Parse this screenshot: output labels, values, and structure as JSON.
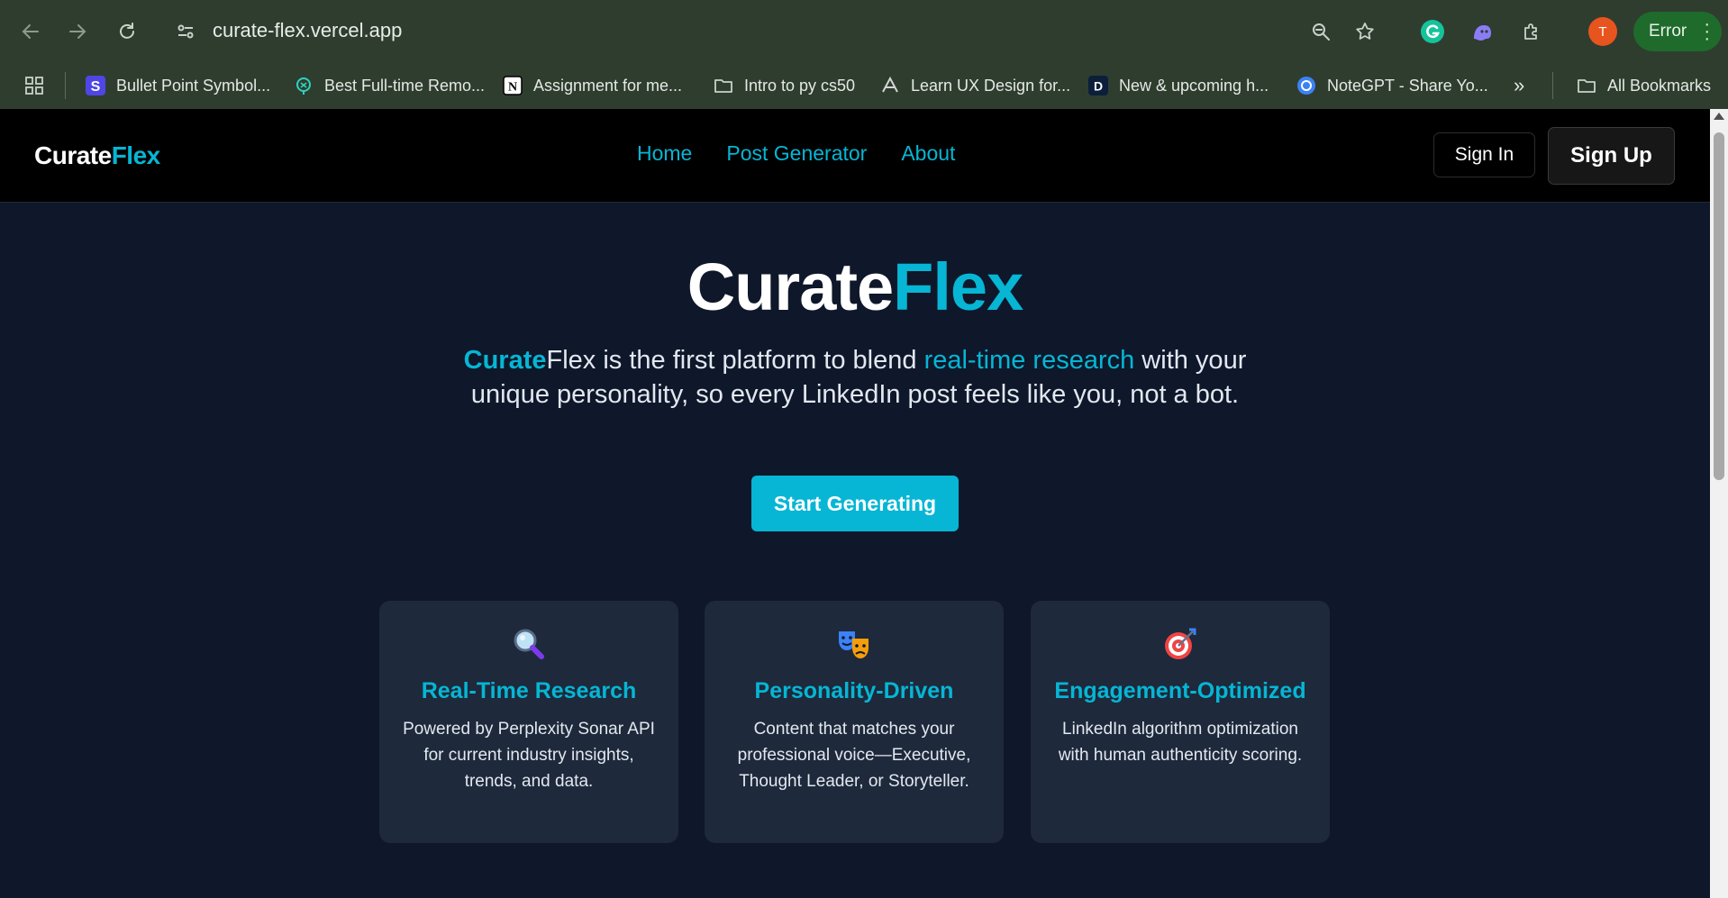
{
  "browser": {
    "url": "curate-flex.vercel.app",
    "profile_initial": "T",
    "error_label": "Error",
    "bookmarks": [
      {
        "label": "Bullet Point Symbol...",
        "icon": "s-logo-icon"
      },
      {
        "label": "Best Full-time Remo...",
        "icon": "location-pin-icon"
      },
      {
        "label": "Assignment for me...",
        "icon": "notion-icon"
      },
      {
        "label": "Intro to py cs50",
        "icon": "folder-icon"
      },
      {
        "label": "Learn UX Design for...",
        "icon": "site-icon"
      },
      {
        "label": "New & upcoming h...",
        "icon": "d-logo-icon"
      },
      {
        "label": "NoteGPT - Share Yo...",
        "icon": "swirl-icon"
      }
    ],
    "more_label": "»",
    "all_bookmarks_label": "All Bookmarks"
  },
  "nav": {
    "logo_part1": "Curate",
    "logo_part2": "Flex",
    "links": [
      "Home",
      "Post Generator",
      "About"
    ],
    "sign_in": "Sign In",
    "sign_up": "Sign Up"
  },
  "hero": {
    "title_part1": "Curate",
    "title_part2": "Flex",
    "sub_brand1": "Curate",
    "sub_brand2": "Flex",
    "sub_text1": " is the first platform to blend ",
    "sub_highlight": "real-time research",
    "sub_text2": " with your unique personality, so every LinkedIn post feels like you, not a bot.",
    "cta": "Start Generating"
  },
  "features": [
    {
      "title": "Real-Time Research",
      "description": "Powered by Perplexity Sonar API for current industry insights, trends, and data.",
      "icon": "magnifier-icon"
    },
    {
      "title": "Personality-Driven",
      "description": "Content that matches your professional voice—Executive, Thought Leader, or Storyteller.",
      "icon": "theater-masks-icon"
    },
    {
      "title": "Engagement-Optimized",
      "description": "LinkedIn algorithm optimization with human authenticity scoring.",
      "icon": "target-icon"
    }
  ],
  "colors": {
    "accent": "#06b6d4",
    "background": "#0f172a",
    "card": "#1e293b",
    "nav": "#000000"
  }
}
